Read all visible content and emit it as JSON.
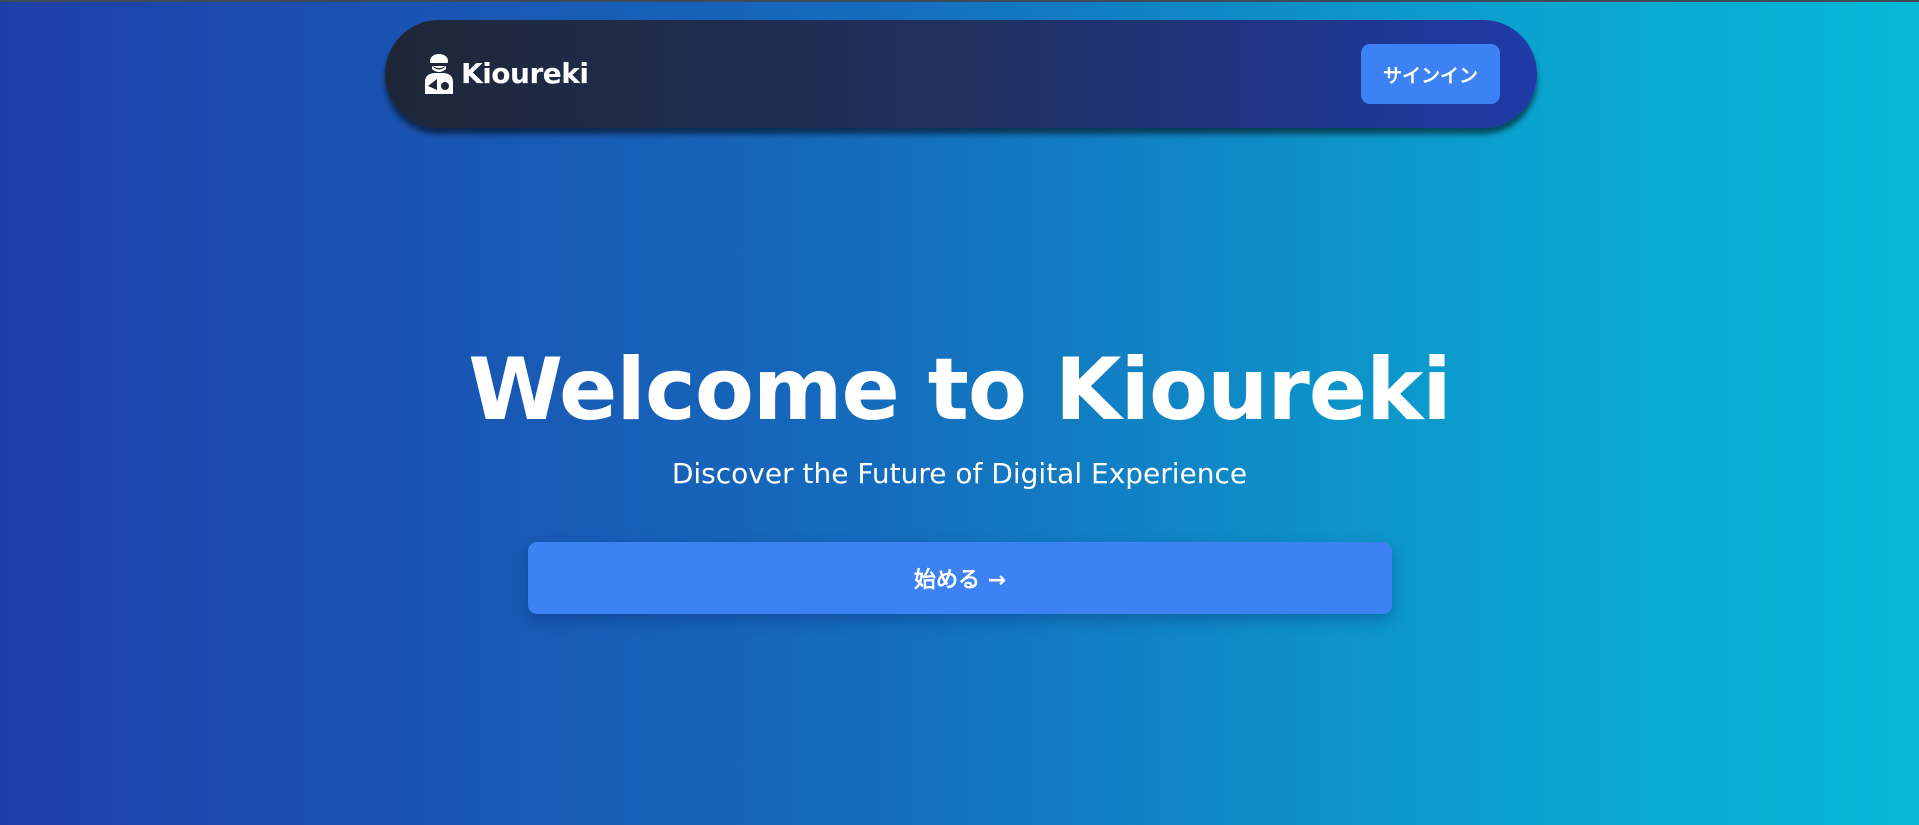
{
  "header": {
    "logo_icon": "worker-icon",
    "brand_name": "Kioureki",
    "signin_label": "サインイン"
  },
  "hero": {
    "title": "Welcome to Kioureki",
    "subtitle": "Discover the Future of Digital Experience",
    "cta_label": "始める →"
  },
  "colors": {
    "accent": "#3c82f5",
    "background_start": "#1e3fa8",
    "background_end": "#06b8d8",
    "navbar_start": "#1e2738",
    "navbar_end": "#1f3aa7"
  }
}
